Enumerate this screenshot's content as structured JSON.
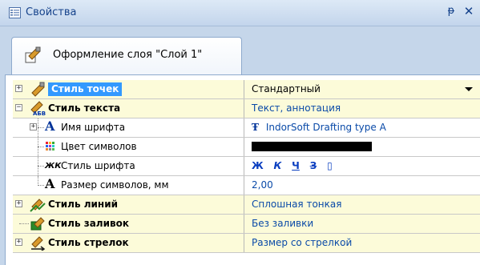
{
  "window": {
    "title": "Свойства",
    "pin_glyph": "ᵽ",
    "close_glyph": "✕"
  },
  "tab": {
    "label": "Оформление слоя \"Слой 1\""
  },
  "rows": [
    {
      "label": "Стиль точек",
      "value": "Стандартный",
      "type": "category",
      "expander": "+",
      "selected": true
    },
    {
      "label": "Стиль текста",
      "value": "Текст, аннотация",
      "type": "category",
      "expander": "−"
    },
    {
      "label": "Имя шрифта",
      "value": "IndorSoft Drafting type A",
      "type": "sub",
      "expander": "+",
      "icon_glyph": "A",
      "value_icon": "Ŧ"
    },
    {
      "label": "Цвет символов",
      "value": "",
      "type": "sub"
    },
    {
      "label": "Стиль шрифта",
      "value": "",
      "type": "sub",
      "icon_glyph": "ЖК",
      "buttons": [
        "Ж",
        "К",
        "Ч",
        "З",
        "▯"
      ]
    },
    {
      "label": "Размер символов, мм",
      "value": "2,00",
      "type": "sub",
      "icon_glyph": "A"
    },
    {
      "label": "Стиль линий",
      "value": "Сплошная тонкая",
      "type": "category",
      "expander": "+"
    },
    {
      "label": "Стиль заливок",
      "value": "Без заливки",
      "type": "category"
    },
    {
      "label": "Стиль стрелок",
      "value": "Размер со стрелкой",
      "type": "category",
      "expander": "+"
    }
  ],
  "colors": {
    "selection": "#3399ff",
    "category_bg": "#fcfbd9",
    "value_text": "#0a4aa8",
    "swatch": "#000000"
  }
}
